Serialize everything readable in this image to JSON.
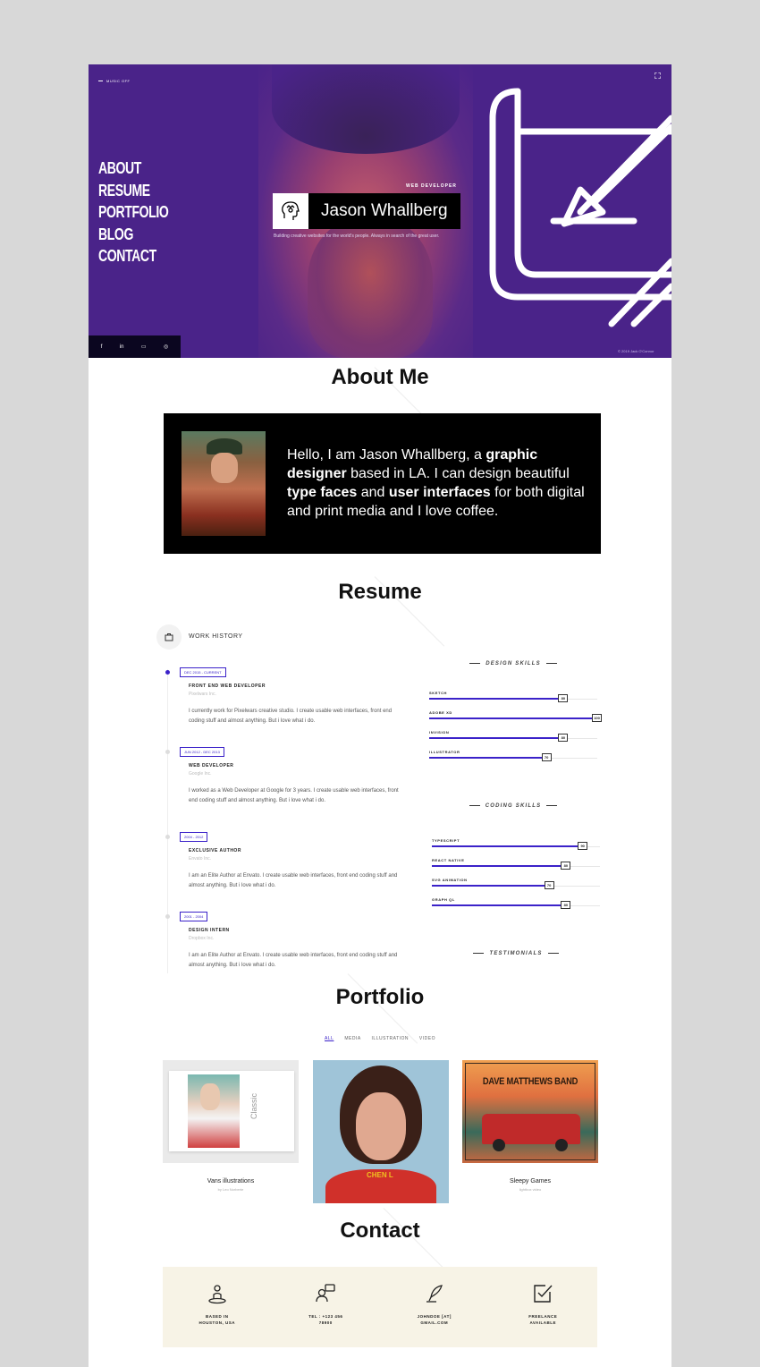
{
  "hero": {
    "music_label": "MUSIC OFF",
    "nav": [
      "ABOUT",
      "RESUME",
      "PORTFOLIO",
      "BLOG",
      "CONTACT"
    ],
    "role": "WEB DEVELOPER",
    "name": "Jason Whallberg",
    "tagline": "Building creative websites for the world's people. Always in search of the great user.",
    "copyright": "© 2019 Jack O'Connor",
    "social": [
      "f",
      "in",
      "▭",
      "◎"
    ]
  },
  "about": {
    "title": "About Me",
    "text_parts": [
      "Hello, I am Jason Whallberg, a ",
      "graphic designer",
      " based in LA. I can design beautiful ",
      "type faces",
      " and ",
      "user interfaces",
      " for both digital and print media and I love coffee."
    ]
  },
  "resume": {
    "title": "Resume",
    "work_history_label": "WORK HISTORY",
    "jobs": [
      {
        "date": "DEC 2015 - CURRENT",
        "title": "FRONT END WEB DEVELOPER",
        "company": "Pixelwars Inc.",
        "desc": "I currently work for Pixelwars creative studio. I create usable web interfaces, front end coding stuff and almost anything. But i love what i do."
      },
      {
        "date": "JUN 2012 - DEC 2013",
        "title": "WEB DEVELOPER",
        "company": "Google Inc.",
        "desc": "I worked as a Web Developer at Google for 3 years. I create usable web interfaces, front end coding stuff and almost anything. But i love what i do."
      },
      {
        "date": "2004 - 2012",
        "title": "EXCLUSIVE AUTHOR",
        "company": "Envato Inc.",
        "desc": "I am an Elite Author at Envato. I create usable web interfaces, front end coding stuff and almost anything. But i love what i do."
      },
      {
        "date": "2001 - 2004",
        "title": "DESIGN INTERN",
        "company": "Dropbox Inc.",
        "desc": "I am an Elite Author at Envato. I create usable web interfaces, front end coding stuff and almost anything. But i love what i do."
      }
    ],
    "design_skills_label": "DESIGN SKILLS",
    "design_skills": [
      {
        "name": "SKETCH",
        "value": 80
      },
      {
        "name": "ADOBE XD",
        "value": 100
      },
      {
        "name": "INVISION",
        "value": 80
      },
      {
        "name": "ILLUSTRATOR",
        "value": 70
      }
    ],
    "coding_skills_label": "CODING SKILLS",
    "coding_skills": [
      {
        "name": "TYPESCRIPT",
        "value": 90
      },
      {
        "name": "REACT NATIVE",
        "value": 80
      },
      {
        "name": "SVG ANIMATION",
        "value": 70
      },
      {
        "name": "GRAPH QL",
        "value": 80
      }
    ],
    "testimonials_label": "TESTIMONIALS"
  },
  "portfolio": {
    "title": "Portfolio",
    "filters": [
      "ALL",
      "MEDIA",
      "ILLUSTRATION",
      "VIDEO"
    ],
    "items": [
      {
        "title": "Vans illustrations",
        "sub": "by Leo Norberte",
        "classic": "Classic"
      },
      {
        "title": "",
        "sub": "",
        "shirt": "CHEN L"
      },
      {
        "title": "Sleepy Games",
        "sub": "lightbox video",
        "poster": "DAVE MATTHEWS BAND"
      }
    ]
  },
  "contact": {
    "title": "Contact",
    "items": [
      {
        "line1": "BASED IN",
        "line2": "HOUSTON, USA",
        "icon": "location-icon"
      },
      {
        "line1": "TEL : +123 456",
        "line2": "78900",
        "icon": "phone-chat-icon"
      },
      {
        "line1": "JOHNDOE [AT]",
        "line2": "GMAIL.COM",
        "icon": "quill-icon"
      },
      {
        "line1": "FREELANCE",
        "line2": "AVAILABLE",
        "icon": "checkbox-icon"
      }
    ]
  },
  "colors": {
    "accent": "#3b22c9",
    "hero_bg": "#4a2389",
    "about_bg": "#000000",
    "contact_bg": "#f7f3e6"
  }
}
